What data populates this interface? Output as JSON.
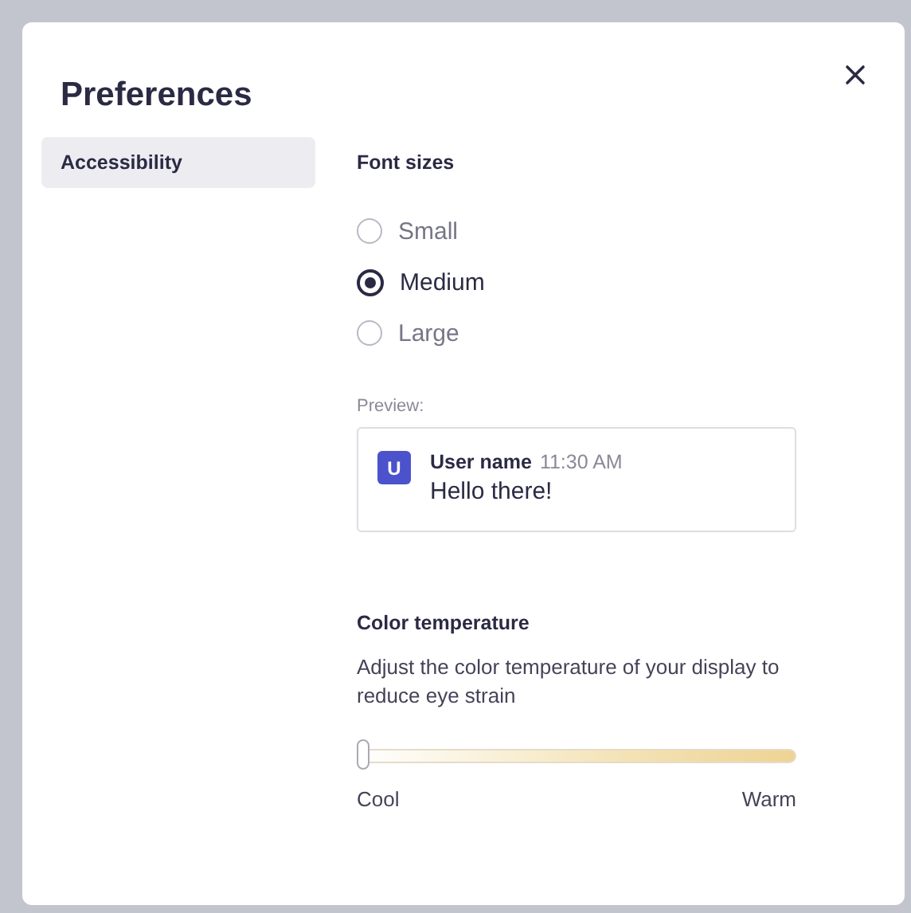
{
  "dialog": {
    "title": "Preferences",
    "sidebar": {
      "items": [
        {
          "label": "Accessibility",
          "selected": true
        }
      ]
    },
    "font_sizes": {
      "heading": "Font sizes",
      "options": [
        {
          "label": "Small",
          "selected": false
        },
        {
          "label": "Medium",
          "selected": true
        },
        {
          "label": "Large",
          "selected": false
        }
      ]
    },
    "preview": {
      "label": "Preview:",
      "avatar": "U",
      "user_name": "User name",
      "time": "11:30 AM",
      "message": "Hello there!"
    },
    "color_temperature": {
      "heading": "Color temperature",
      "description": "Adjust the color temperature of your display to reduce eye strain",
      "slider": {
        "level": 0,
        "min_label": "Cool",
        "max_label": "Warm"
      }
    }
  }
}
